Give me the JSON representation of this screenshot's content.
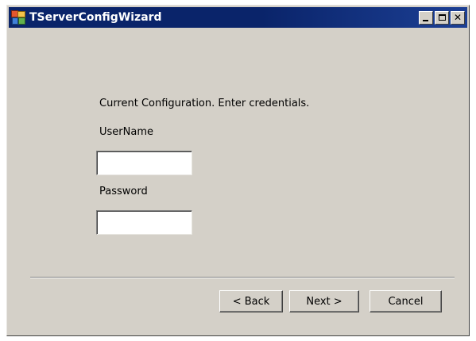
{
  "window": {
    "title": "TServerConfigWizard",
    "controls": {
      "minimize_icon": "minimize-icon",
      "maximize_icon": "maximize-icon",
      "close_symbol": "✕"
    },
    "app_icon": "app-icon"
  },
  "form": {
    "prompt": "Current Configuration. Enter credentials.",
    "username_label": "UserName",
    "username_value": "",
    "password_label": "Password",
    "password_value": ""
  },
  "buttons": {
    "back": "< Back",
    "next": "Next >",
    "cancel": "Cancel"
  },
  "colors": {
    "titlebar": "#0a246a",
    "dialog_face": "#d4d0c8",
    "title_text": "#ffffff"
  }
}
